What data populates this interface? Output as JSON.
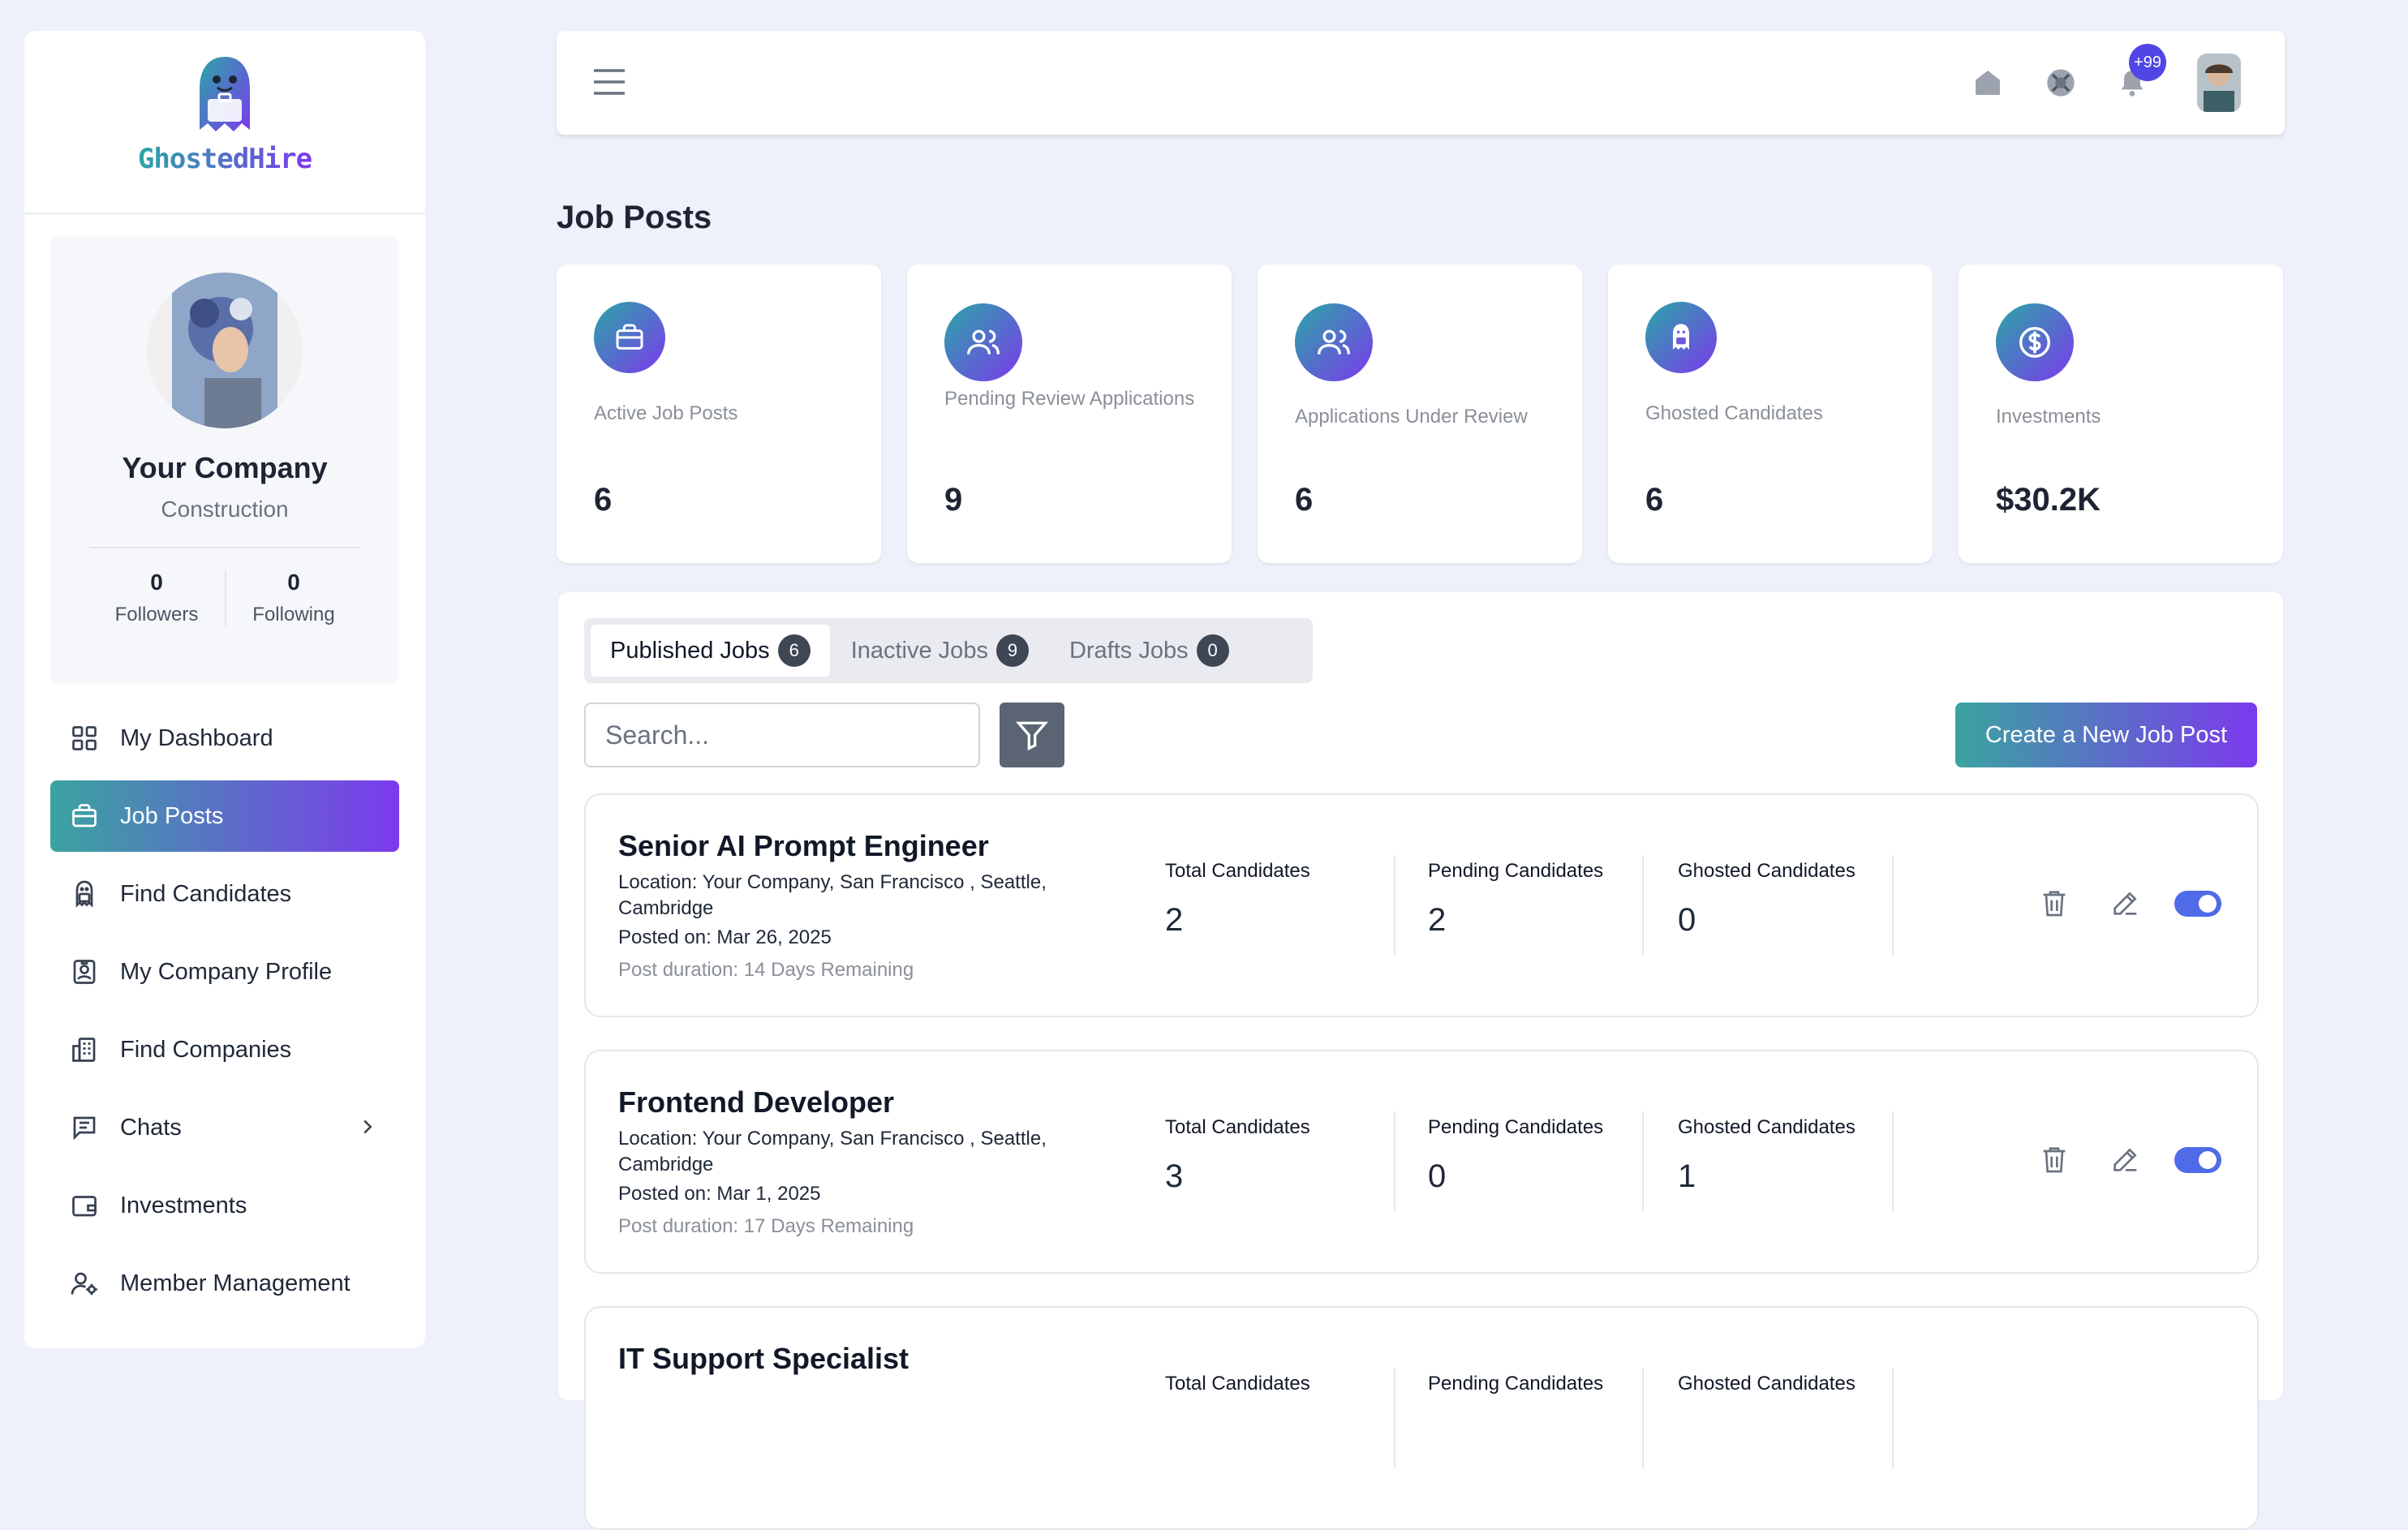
{
  "brand": {
    "name": "GhostedHire"
  },
  "profile": {
    "company_name": "Your Company",
    "company_type": "Construction",
    "followers_count": "0",
    "followers_label": "Followers",
    "following_count": "0",
    "following_label": "Following"
  },
  "sidebar": {
    "items": [
      {
        "label": "My Dashboard",
        "icon": "dashboard-grid-icon"
      },
      {
        "label": "Job Posts",
        "icon": "briefcase-icon",
        "active": true
      },
      {
        "label": "Find Candidates",
        "icon": "ghost-icon"
      },
      {
        "label": "My Company Profile",
        "icon": "id-badge-icon"
      },
      {
        "label": "Find Companies",
        "icon": "building-icon"
      },
      {
        "label": "Chats",
        "icon": "chat-icon"
      },
      {
        "label": "Investments",
        "icon": "wallet-icon"
      },
      {
        "label": "Member Management",
        "icon": "user-settings-icon"
      }
    ]
  },
  "topbar": {
    "notification_badge": "+99",
    "icons": [
      "menu-icon",
      "home-icon",
      "globe-icon",
      "bell-icon"
    ]
  },
  "page": {
    "title": "Job Posts"
  },
  "stats": [
    {
      "label": "Active Job Posts",
      "value": "6",
      "icon": "briefcase-icon"
    },
    {
      "label": "Pending Review Applications",
      "value": "9",
      "icon": "users-icon"
    },
    {
      "label": "Applications Under Review",
      "value": "6",
      "icon": "users-icon"
    },
    {
      "label": "Ghosted Candidates",
      "value": "6",
      "icon": "ghost-icon"
    },
    {
      "label": "Investments",
      "value": "$30.2K",
      "icon": "dollar-icon"
    }
  ],
  "tabs": [
    {
      "label": "Published Jobs",
      "count": "6",
      "active": true
    },
    {
      "label": "Inactive Jobs",
      "count": "9"
    },
    {
      "label": "Drafts Jobs",
      "count": "0"
    }
  ],
  "search": {
    "placeholder": "Search..."
  },
  "create_button": "Create a New Job Post",
  "column_labels": {
    "total": "Total Candidates",
    "pending": "Pending Candidates",
    "ghosted": "Ghosted Candidates"
  },
  "jobs": [
    {
      "title": "Senior AI Prompt Engineer",
      "location": "Location: Your Company, San Francisco , Seattle, Cambridge",
      "posted": "Posted on: Mar 26, 2025",
      "duration": "Post duration: 14 Days Remaining",
      "total": "2",
      "pending": "2",
      "ghosted": "0",
      "enabled": true
    },
    {
      "title": "Frontend Developer",
      "location": "Location: Your Company, San Francisco , Seattle, Cambridge",
      "posted": "Posted on: Mar 1, 2025",
      "duration": "Post duration: 17 Days Remaining",
      "total": "3",
      "pending": "0",
      "ghosted": "1",
      "enabled": true
    },
    {
      "title": "IT Support Specialist",
      "location": "",
      "posted": "",
      "duration": "",
      "total": "",
      "pending": "",
      "ghosted": "",
      "enabled": true
    }
  ],
  "colors": {
    "accent_start": "#3aa4a0",
    "accent_end": "#7c3aed",
    "toggle": "#4f6be8",
    "badge": "#4f46e5"
  }
}
